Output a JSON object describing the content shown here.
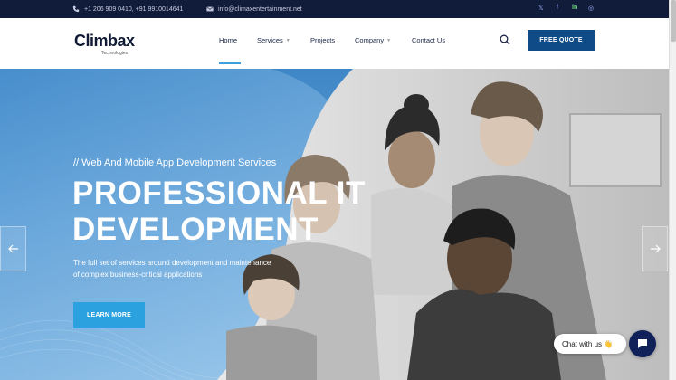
{
  "topbar": {
    "phone": "+1 206 909 0410, +91 9910014641",
    "email": "info@climaxentertainment.net",
    "social": [
      {
        "icon": "twitter-icon",
        "glyph": "𝕏"
      },
      {
        "icon": "facebook-icon",
        "glyph": "f"
      },
      {
        "icon": "linkedin-icon",
        "glyph": "in"
      },
      {
        "icon": "instagram-icon",
        "glyph": "◎"
      }
    ]
  },
  "header": {
    "logo_text": "Climbax",
    "logo_sub": "Technologies",
    "nav": [
      {
        "label": "Home",
        "active": true
      },
      {
        "label": "Services",
        "dropdown": true
      },
      {
        "label": "Projects"
      },
      {
        "label": "Company",
        "dropdown": true
      },
      {
        "label": "Contact Us"
      }
    ],
    "quote_label": "FREE QUOTE"
  },
  "hero": {
    "subtitle": "// Web And Mobile App Development Services",
    "headline_line1": "PROFESSIONAL IT",
    "headline_line2": "DEVELOPMENT",
    "desc_line1": "The full set of services around development and maintenance",
    "desc_line2": "of complex business-critical applications",
    "cta_label": "LEARN MORE"
  },
  "chat": {
    "label": "Chat with us 👋"
  },
  "colors": {
    "topbar_bg": "#111b3a",
    "quote_btn": "#0e4b87",
    "cta_btn": "#2ba2df",
    "nav_active_underline": "#3aa0e0",
    "chat_btn": "#10215a"
  }
}
